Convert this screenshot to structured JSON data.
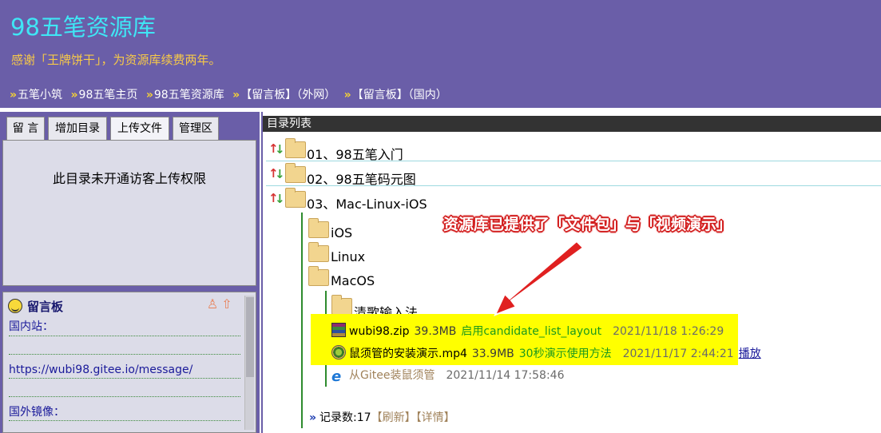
{
  "header": {
    "title": "98五笔资源库",
    "thanks": "感谢「王牌饼干」，为资源库续费两年。",
    "breadcrumb": [
      {
        "sep": "»",
        "label": "五笔小筑"
      },
      {
        "sep": "»",
        "label": "98五笔主页"
      },
      {
        "sep": "»",
        "label": "98五笔资源库"
      },
      {
        "sep": "»",
        "label": "【留言板】（外网）"
      },
      {
        "sep": "»",
        "label": "【留言板】（国内）"
      }
    ]
  },
  "left": {
    "tabs": [
      {
        "label": "留 言"
      },
      {
        "label": "增加目录"
      },
      {
        "label": "上传文件"
      },
      {
        "label": "管理区"
      }
    ],
    "upload_message": "此目录未开通访客上传权限",
    "msgboard": {
      "title": "留言板",
      "lines": [
        "国内站：",
        "",
        "https://wubi98.gitee.io/message/",
        "",
        "国外镜像：",
        ""
      ]
    }
  },
  "right": {
    "title": "目录列表",
    "top_items": [
      {
        "label": "01、98五笔入门"
      },
      {
        "label": "02、98五笔码元图"
      },
      {
        "label": "03、Mac-Linux-iOS"
      }
    ],
    "sub_folders": [
      {
        "label": "iOS"
      },
      {
        "label": "Linux"
      },
      {
        "label": "MacOS"
      }
    ],
    "macos_child": {
      "label": "清歌输入法"
    },
    "files": [
      {
        "name": "wubi98.zip",
        "size": "39.3MB",
        "desc": "启用candidate_list_layout",
        "date": "2021/11/18 1:26:29",
        "icon": "zip-icon"
      },
      {
        "name": "鼠须管的安装演示.mp4",
        "size": "33.9MB",
        "desc": "30秒演示使用方法",
        "date": "2021/11/17 2:44:21",
        "icon": "mp4-icon",
        "action": "播放"
      },
      {
        "name": "从Gitee装鼠须管",
        "date": "2021/11/14 17:58:46",
        "icon": "ie-icon"
      }
    ],
    "records": {
      "label": "记录数:17",
      "refresh": "【刷新】",
      "details": "【详情】"
    }
  },
  "annotation": "资源库已提供了「文件包」与「视频演示」",
  "colors": {
    "header_bg": "#6a5ea8",
    "title": "#3fe6f5",
    "thanks": "#f7c948",
    "highlight": "#ffff00",
    "annotation": "#d32020"
  }
}
